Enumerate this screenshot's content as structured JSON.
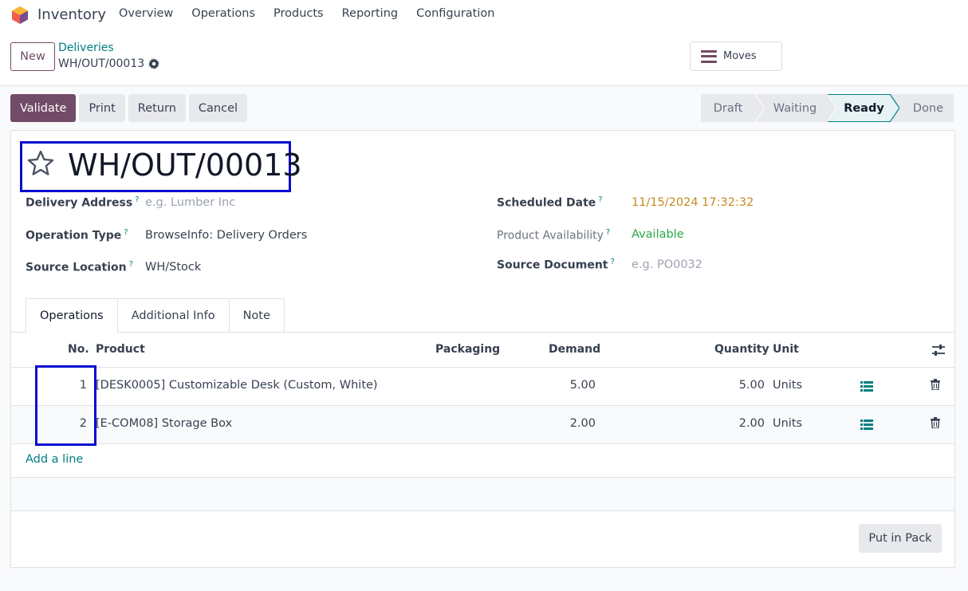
{
  "nav": {
    "app_name": "Inventory",
    "menu": [
      "Overview",
      "Operations",
      "Products",
      "Reporting",
      "Configuration"
    ]
  },
  "control": {
    "new_label": "New",
    "breadcrumb": "Deliveries",
    "record": "WH/OUT/00013",
    "moves_label": "Moves"
  },
  "actions": [
    "Validate",
    "Print",
    "Return",
    "Cancel"
  ],
  "stages": [
    {
      "label": "Draft",
      "current": false
    },
    {
      "label": "Waiting",
      "current": false
    },
    {
      "label": "Ready",
      "current": true
    },
    {
      "label": "Done",
      "current": false
    }
  ],
  "form": {
    "title": "WH/OUT/00013",
    "delivery_address_label": "Delivery Address",
    "delivery_address_placeholder": "e.g. Lumber Inc",
    "operation_type_label": "Operation Type",
    "operation_type_value": "BrowseInfo: Delivery Orders",
    "source_location_label": "Source Location",
    "source_location_value": "WH/Stock",
    "scheduled_date_label": "Scheduled Date",
    "scheduled_date_value": "11/15/2024 17:32:32",
    "availability_label": "Product Availability",
    "availability_value": "Available",
    "source_document_label": "Source Document",
    "source_document_placeholder": "e.g. PO0032",
    "help_mark": "?"
  },
  "tabs": [
    "Operations",
    "Additional Info",
    "Note"
  ],
  "table": {
    "headers": {
      "no": "No.",
      "product": "Product",
      "packaging": "Packaging",
      "demand": "Demand",
      "quantity": "Quantity",
      "unit": "Unit"
    },
    "rows": [
      {
        "no": "1",
        "product": "[DESK0005] Customizable Desk (Custom, White)",
        "demand": "5.00",
        "quantity": "5.00",
        "unit": "Units"
      },
      {
        "no": "2",
        "product": "[E-COM08] Storage Box",
        "demand": "2.00",
        "quantity": "2.00",
        "unit": "Units"
      }
    ],
    "add_line": "Add a line"
  },
  "footer": {
    "put_in_pack": "Put in Pack"
  },
  "colors": {
    "brand": "#714b67",
    "link": "#017e84",
    "highlight_box": "#0a0ad0",
    "date": "#c58a1f",
    "available": "#28a745"
  }
}
